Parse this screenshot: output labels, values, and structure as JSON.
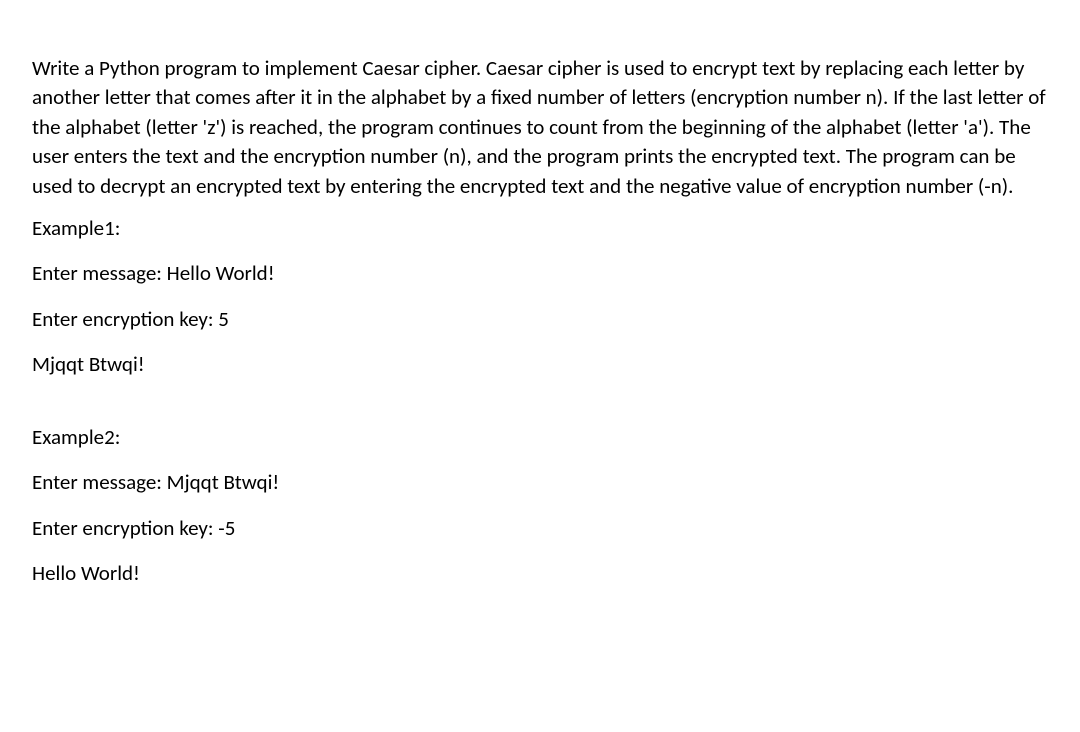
{
  "intro": "Write a Python program to implement Caesar cipher. Caesar cipher is used to encrypt text by replacing each letter by another letter that comes after it in the alphabet by a fixed number of letters (encryption number n). If the last letter of the alphabet (letter 'z') is reached, the program continues to count from the beginning of the alphabet (letter 'a'). The user enters the text and the encryption number (n), and the program prints the encrypted text. The program can be used to decrypt an encrypted text by entering the encrypted text and the negative value of encryption number (-n).",
  "example1": {
    "title": "Example1:",
    "enter_message": "Enter message: Hello World!",
    "enter_key": "Enter encryption key: 5",
    "output": "Mjqqt Btwqi!"
  },
  "example2": {
    "title": "Example2:",
    "enter_message": "Enter message: Mjqqt Btwqi!",
    "enter_key": "Enter encryption key: -5",
    "output": "Hello World!"
  }
}
